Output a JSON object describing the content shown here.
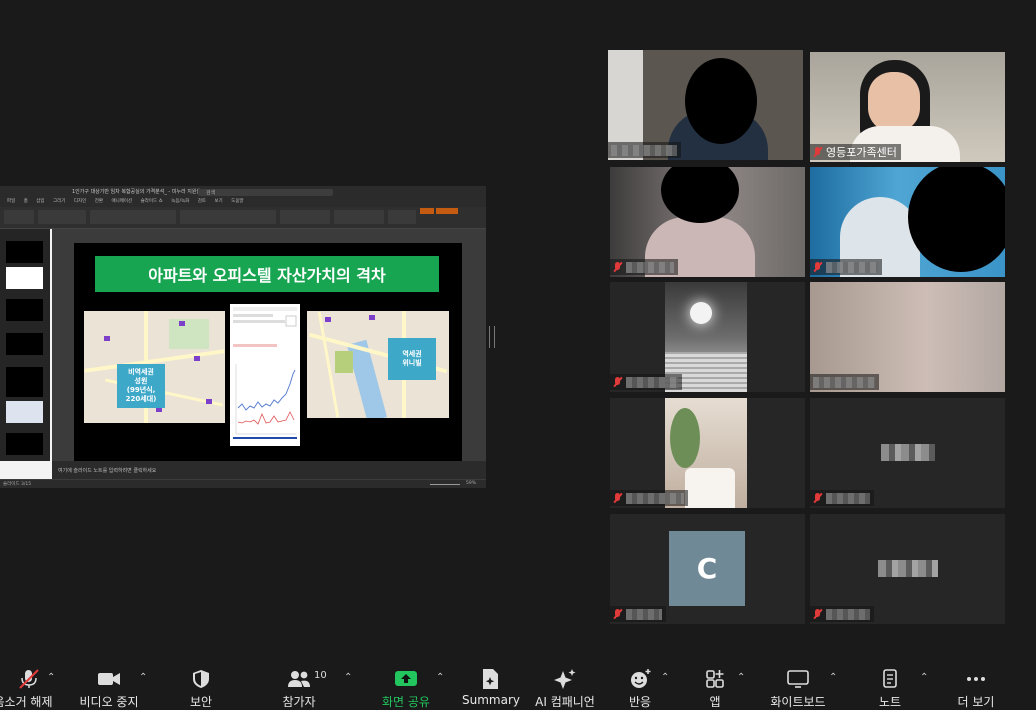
{
  "share": {
    "window_title": "1인가구 대상기반 임차 복합공실의 가격분석_ - 미누라 지원을",
    "search_placeholder": "검색",
    "menu": [
      "파일",
      "홈",
      "삽입",
      "그리기",
      "디자인",
      "전환",
      "애니메이션",
      "슬라이드 쇼",
      "녹음/녹화",
      "검토",
      "보기",
      "도움말"
    ],
    "slide_title": "아파트와 오피스텔 자산가치의 격차",
    "callout_left": "비역세권\n성원\n(99년식,\n220세대)",
    "callout_right": "역세권\n위니빌",
    "notes_placeholder": "여기에 슬라이드 노트를 입력하려면 클릭하세요",
    "status_left": "슬라이드 3/15",
    "zoom": "59%"
  },
  "gallery": {
    "tiles": [
      {
        "name": "",
        "muted": false,
        "active_speaker": true
      },
      {
        "name": "영등포가족센터",
        "muted": true,
        "active_speaker": false
      },
      {
        "name": "",
        "muted": true
      },
      {
        "name": "",
        "muted": true
      },
      {
        "name": "",
        "muted": true
      },
      {
        "name": "",
        "muted": false
      },
      {
        "name": "",
        "muted": true
      },
      {
        "name": "",
        "muted": true
      },
      {
        "name": "",
        "muted": true,
        "avatar": "C"
      },
      {
        "name": "",
        "muted": true
      }
    ]
  },
  "toolbar": {
    "mic_label": "음소거 해제",
    "video_label": "비디오 중지",
    "security_label": "보안",
    "participants_label": "참가자",
    "participants_count": "10",
    "share_label": "화면 공유",
    "summary_label": "Summary",
    "ai_label": "AI 컴패니언",
    "reactions_label": "반응",
    "apps_label": "앱",
    "whiteboard_label": "화이트보드",
    "notes_label": "노트",
    "more_label": "더 보기"
  },
  "colors": {
    "share_green": "#22c55e",
    "speaker_border": "#c8e64a",
    "slide_title_bg": "#18a552"
  }
}
